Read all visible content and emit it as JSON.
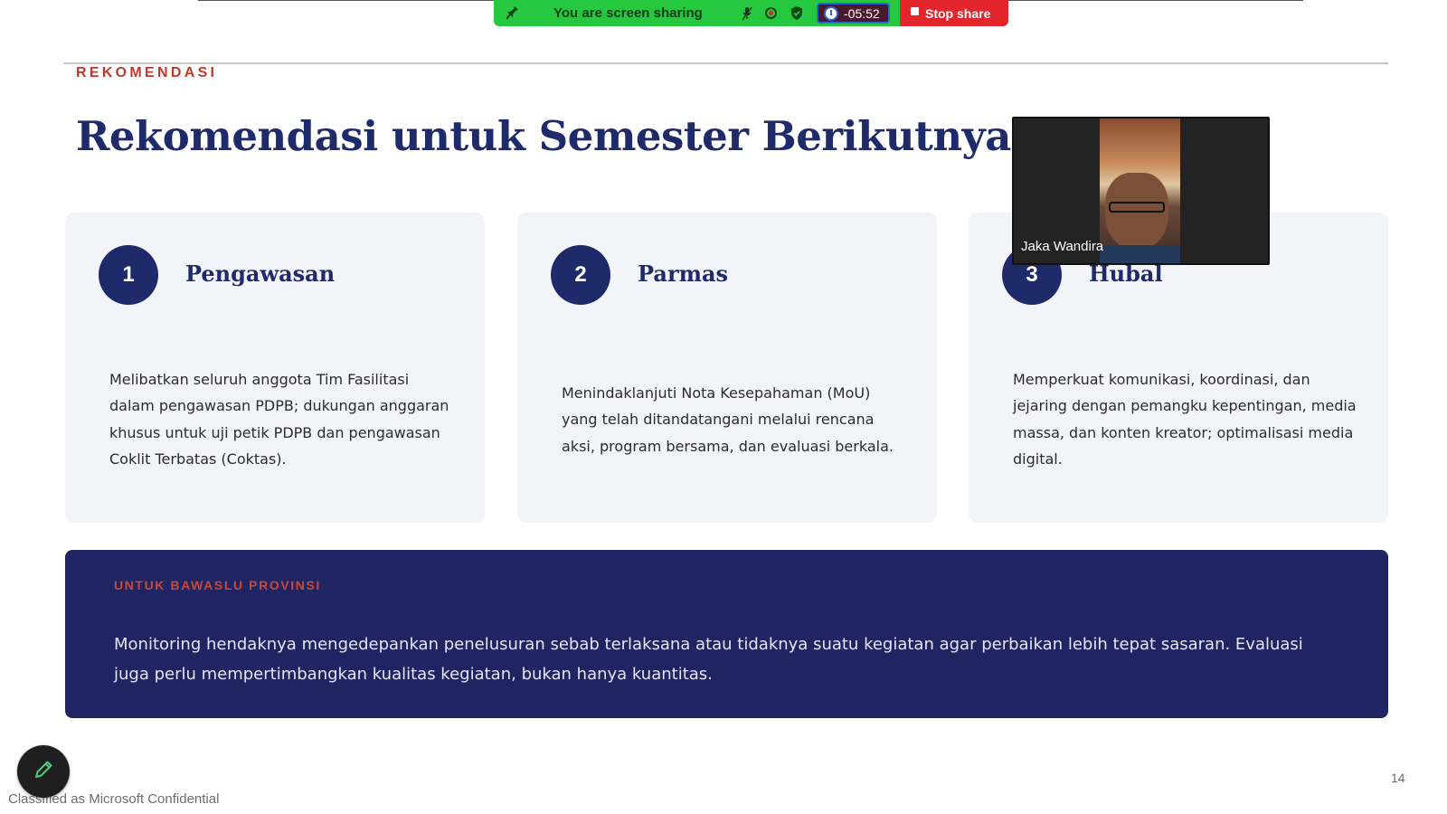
{
  "share_bar": {
    "label": "You are screen sharing",
    "timer": "-05:52",
    "stop_label": "Stop share",
    "icons": [
      "pin-icon",
      "mic-muted-icon",
      "record-icon",
      "shield-icon",
      "clock-icon",
      "stop-icon"
    ],
    "colors": {
      "green": "#25c83e",
      "red": "#e3262c"
    }
  },
  "slide": {
    "eyebrow": "REKOMENDASI",
    "title": "Rekomendasi untuk Semester Berikutnya",
    "cards": [
      {
        "number": "1",
        "title": "Pengawasan",
        "body": "Melibatkan seluruh anggota Tim Fasilitasi dalam pengawasan PDPB; dukungan anggaran khusus untuk uji petik PDPB dan pengawasan Coklit Terbatas (Coktas)."
      },
      {
        "number": "2",
        "title": "Parmas",
        "body": "Menindaklanjuti Nota Kesepahaman (MoU) yang telah ditandatangani melalui rencana aksi, program bersama, dan evaluasi berkala."
      },
      {
        "number": "3",
        "title": "Hubal",
        "body": "Memperkuat komunikasi, koordinasi, dan jejaring dengan pemangku kepentingan, media massa, dan konten kreator; optimalisasi media digital."
      }
    ],
    "banner": {
      "label": "UNTUK BAWASLU PROVINSI",
      "text": "Monitoring hendaknya mengedepankan penelusuran sebab terlaksana atau tidaknya suatu kegiatan agar perbaikan lebih tepat sasaran. Evaluasi juga perlu mempertimbangkan kualitas kegiatan, bukan hanya kuantitas."
    },
    "page_number": "14",
    "colors": {
      "navy": "#1f2a6b",
      "accent": "#c0392b",
      "card_bg": "#f3f4f9"
    }
  },
  "video": {
    "participant_name": "Jaka Wandira"
  },
  "footer": {
    "classification": "Classified as Microsoft Confidential",
    "pen_icon": "pen-icon"
  }
}
